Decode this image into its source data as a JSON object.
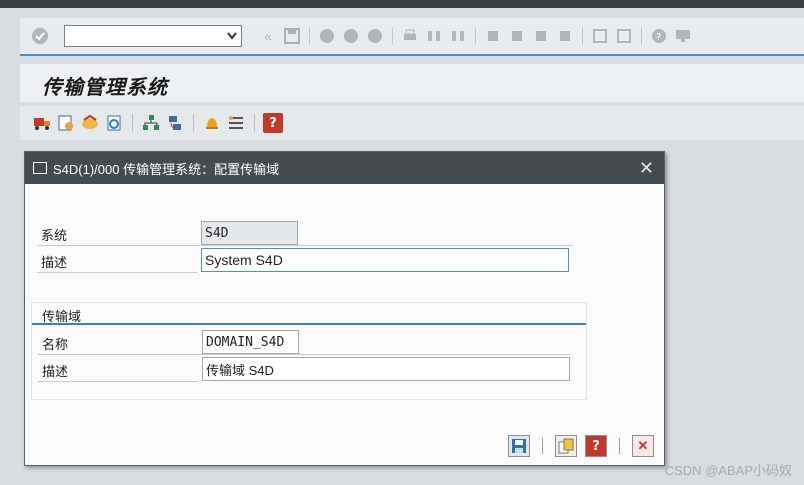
{
  "app": {
    "title": "传输管理系统"
  },
  "dialog": {
    "title": "S4D(1)/000 传输管理系统：配置传输域",
    "system_label": "系统",
    "system_value": "S4D",
    "desc_label": "描述",
    "desc_value": "System S4D",
    "group_title": "传输域",
    "name_label": "名称",
    "name_value": "DOMAIN_S4D",
    "domain_desc_label": "描述",
    "domain_desc_value": "传输域 S4D"
  },
  "watermark": "CSDN @ABAP小码奴",
  "icons": {
    "close": "✕"
  }
}
